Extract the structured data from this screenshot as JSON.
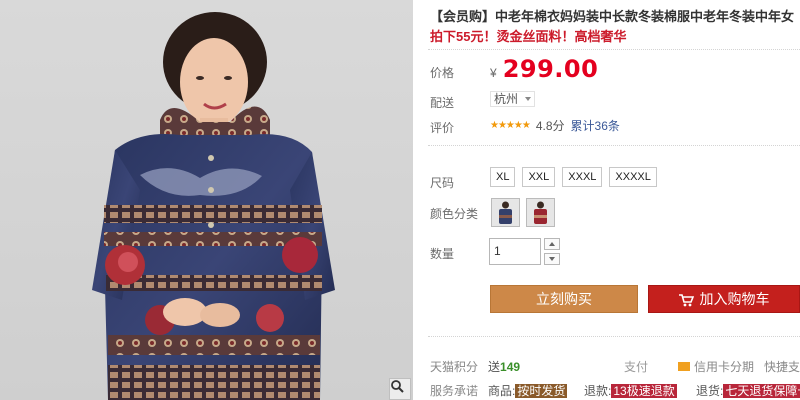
{
  "product": {
    "title": "【会员购】中老年棉衣妈妈装中长款冬装棉服中老年冬装中年女",
    "promo": "拍下55元！烫金丝面料！高档奢华"
  },
  "price": {
    "label": "价格",
    "currency": "¥",
    "value": "299.00"
  },
  "shipping": {
    "label": "配送",
    "city": "杭州"
  },
  "rating": {
    "label": "评价",
    "stars": "★★★★★",
    "score": "4.8分",
    "reviews": "累计36条"
  },
  "size": {
    "label": "尺码",
    "options": [
      "XL",
      "XXL",
      "XXXL",
      "XXXXL"
    ]
  },
  "color": {
    "label": "颜色分类"
  },
  "quantity": {
    "label": "数量",
    "value": "1"
  },
  "buttons": {
    "buy_now": "立刻购买",
    "add_to_cart": "加入购物车"
  },
  "tmall": {
    "points_label": "天猫积分",
    "send_prefix": "送",
    "points": "149",
    "pay": "支付",
    "credit": "信用卡分期",
    "fast": "快捷支付"
  },
  "service": {
    "label": "服务承诺",
    "item1_prefix": "商品:",
    "item1_tag": "按时发货",
    "item2_prefix": "退款:",
    "item2_tag": "13极速退款",
    "item3_prefix": "退货:",
    "item3_tag": "七天退货保障卡"
  },
  "colors": {
    "price": "#e4001f",
    "promo": "#cc1b2b",
    "buy_button": "#cd8848",
    "cart_button": "#c4201d",
    "stars": "#f29a0c"
  },
  "icons": [
    "zoom-icon",
    "cart-icon",
    "caret-down-icon",
    "arrow-up-icon",
    "arrow-down-icon",
    "credit-card-icon"
  ]
}
